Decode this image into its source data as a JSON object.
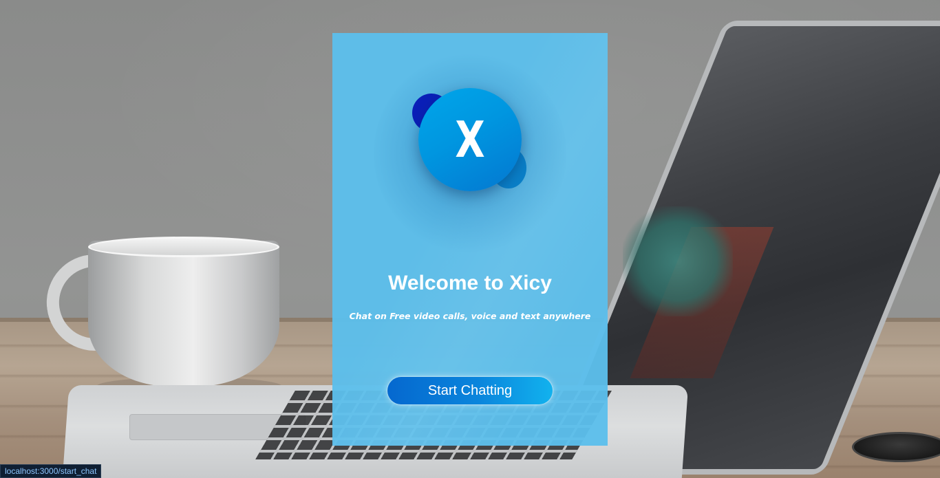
{
  "card": {
    "logo_letter": "X",
    "title": "Welcome to Xicy",
    "subtitle": "Chat on Free video calls, voice and text anywhere",
    "start_button_label": "Start Chatting"
  },
  "status_bar": {
    "url": "localhost:3000/start_chat"
  },
  "colors": {
    "card_background": "#5cbeeb",
    "logo_main": "#0096e0",
    "logo_back_bubble": "#0a1fb8",
    "button_gradient_start": "#0568cf",
    "button_gradient_end": "#12b2ee",
    "text": "#ffffff"
  }
}
